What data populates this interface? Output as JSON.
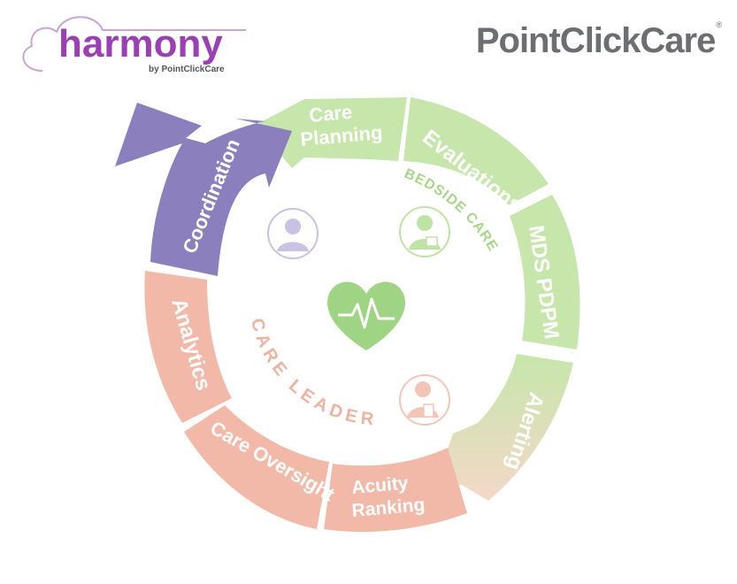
{
  "logos": {
    "harmony_wordmark": "harmony",
    "harmony_byline": "by PointClickCare",
    "pcc_wordmark": "PointClickCare",
    "pcc_mark": "®"
  },
  "colors": {
    "harmony_purple": "#9b3fb4",
    "coordination": "#8b7fbd",
    "bedside_green": "#c6e6ab",
    "bedside_text": "#a7d58a",
    "leaders_salmon": "#f2b9a8",
    "leaders_text": "#eeb2a0",
    "heart": "#9fd484",
    "pcc_gray": "#6d6e71"
  },
  "diagram": {
    "segments": [
      {
        "key": "care_planning",
        "lines": [
          "Care",
          "Planning"
        ]
      },
      {
        "key": "evaluations",
        "lines": [
          "Evaluations"
        ]
      },
      {
        "key": "mds_pdpm",
        "lines": [
          "MDS PDPM"
        ]
      },
      {
        "key": "alerting",
        "lines": [
          "Alerting"
        ]
      },
      {
        "key": "acuity_ranking",
        "lines": [
          "Acuity",
          "Ranking"
        ]
      },
      {
        "key": "care_oversight",
        "lines": [
          "Care Oversight"
        ]
      },
      {
        "key": "analytics",
        "lines": [
          "Analytics"
        ]
      },
      {
        "key": "coordination",
        "lines": [
          "Coordination"
        ]
      }
    ],
    "bedside_care": "BEDSIDE CARE",
    "care_leaders": "CARE LEADERS",
    "icons": [
      "nurse-icon",
      "physician-icon",
      "care-leader-icon",
      "heart-pulse-icon"
    ]
  }
}
